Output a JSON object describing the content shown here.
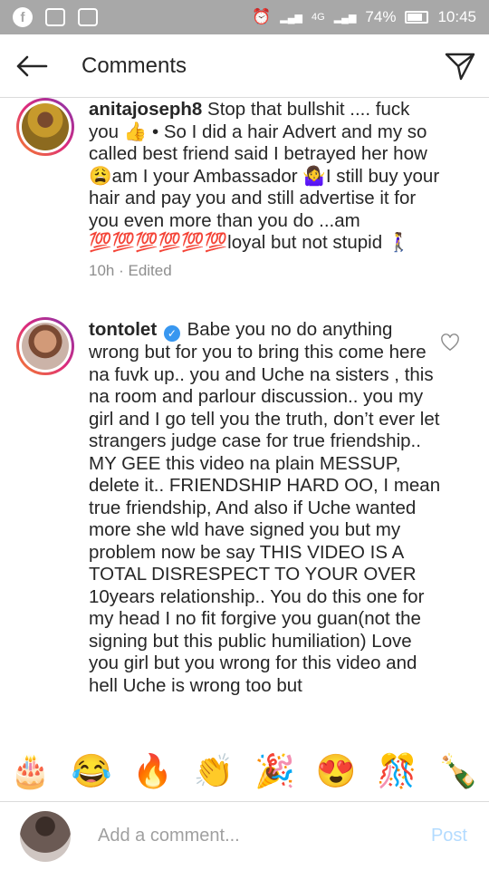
{
  "statusbar": {
    "network1": "4G",
    "battery": "74%",
    "time": "10:45"
  },
  "header": {
    "title": "Comments"
  },
  "comments": [
    {
      "username": "anitajoseph8",
      "text": "Stop that bullshit .... fuck you 👍 • So I did a hair Advert and my so called best friend said I betrayed her how 😩am I your Ambassador 🤷‍♀️I still buy your hair and pay you and still advertise it for you even more than you do ...am 💯💯💯💯💯💯loyal but not stupid 🚶‍♀️",
      "time": "10h",
      "edited": "Edited"
    },
    {
      "username": "tontolet",
      "text": "Babe you no do anything wrong but for you to bring this come here na fuvk up.. you and Uche na sisters , this na room and parlour discussion.. you my girl and I go tell you the truth, don’t ever let strangers judge case for true friendship.. MY GEE this video na plain MESSUP, delete it.. FRIENDSHIP HARD OO, I mean true friendship, And also if Uche wanted more she wld have signed you but my problem now be say THIS VIDEO IS A TOTAL DISRESPECT TO YOUR OVER 10years relationship.. You do this one for my head I no fit forgive you guan(not the signing but this public humiliation) Love you girl but you wrong for this video and hell Uche is wrong too but"
    }
  ],
  "emojis": [
    "🎂",
    "😂",
    "🔥",
    "👏",
    "🎉",
    "😍",
    "🎊",
    "🍾"
  ],
  "composer": {
    "placeholder": "Add a comment...",
    "post_label": "Post"
  }
}
